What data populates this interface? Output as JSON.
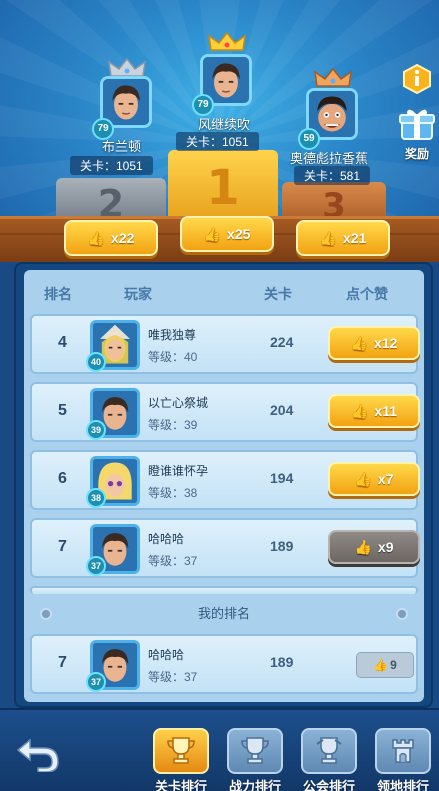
{
  "podium": {
    "first": {
      "name": "风继续吹",
      "level": "79",
      "stage": "关卡：1051",
      "likes": "x25",
      "rank_num": "1"
    },
    "second": {
      "name": "布兰顿",
      "level": "79",
      "stage": "关卡：1051",
      "likes": "x22",
      "rank_num": "2"
    },
    "third": {
      "name": "奥德彪拉香蕉",
      "level": "59",
      "stage": "关卡：581",
      "likes": "x21",
      "rank_num": "3"
    }
  },
  "side_buttons": {
    "info_icon": "info-icon",
    "reward_label": "奖励"
  },
  "table": {
    "headers": {
      "rank": "排名",
      "player": "玩家",
      "stage": "关卡",
      "likes": "点个赞"
    },
    "rows": [
      {
        "rank": "4",
        "name": "唯我独尊",
        "level": "等级：40",
        "badge": "40",
        "stage": "224",
        "likes": "x12",
        "state": "active"
      },
      {
        "rank": "5",
        "name": "以亡心祭城",
        "level": "等级：39",
        "badge": "39",
        "stage": "204",
        "likes": "x11",
        "state": "active"
      },
      {
        "rank": "6",
        "name": "瞪谁谁怀孕",
        "level": "等级：38",
        "badge": "38",
        "stage": "194",
        "likes": "x7",
        "state": "active"
      },
      {
        "rank": "7",
        "name": "哈哈哈",
        "level": "等级：37",
        "badge": "37",
        "stage": "189",
        "likes": "x9",
        "state": "disabled"
      }
    ],
    "my_rank_title": "我的排名",
    "my_row": {
      "rank": "7",
      "name": "哈哈哈",
      "level": "等级：37",
      "badge": "37",
      "stage": "189",
      "likes": "9"
    }
  },
  "nav": {
    "back_icon": "back-arrow-icon",
    "tabs": [
      {
        "label": "关卡排行",
        "active": true
      },
      {
        "label": "战力排行",
        "active": false
      },
      {
        "label": "公会排行",
        "active": false
      },
      {
        "label": "领地排行",
        "active": false
      }
    ]
  },
  "colors": {
    "gold": "#f2a212",
    "panel_bg": "#a9d1ee",
    "stage_bg": "#2a86c8"
  }
}
